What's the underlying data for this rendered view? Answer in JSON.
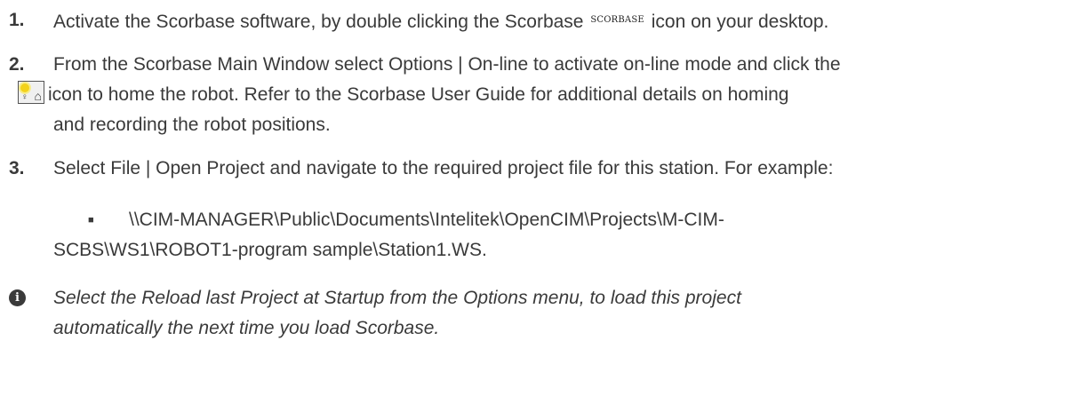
{
  "steps": [
    {
      "number": "1.",
      "text_before_icon": "Activate the Scorbase software, by double clicking the Scorbase ",
      "icon_label": "SCORBASE",
      "text_after_icon": " icon on your desktop."
    },
    {
      "number": "2.",
      "line1": "From the Scorbase Main Window select Options | On-line to activate on-line mode and click the",
      "line2_after_icon": "icon to home the robot. Refer to the Scorbase User Guide for additional details on homing",
      "line3": "and recording the robot positions."
    },
    {
      "number": "3.",
      "line1": "Select File | Open Project and navigate to the required project file for this station. For example:"
    }
  ],
  "example_path": {
    "bullet": "■",
    "line1": "\\\\CIM-MANAGER\\Public\\Documents\\Intelitek\\OpenCIM\\Projects\\M-CIM-",
    "line2": "SCBS\\WS1\\ROBOT1-program sample\\Station1.WS."
  },
  "note": {
    "icon": "i",
    "line1": "Select the Reload last Project at Startup from the Options menu, to load this project",
    "line2": "automatically the next time you load Scorbase."
  }
}
